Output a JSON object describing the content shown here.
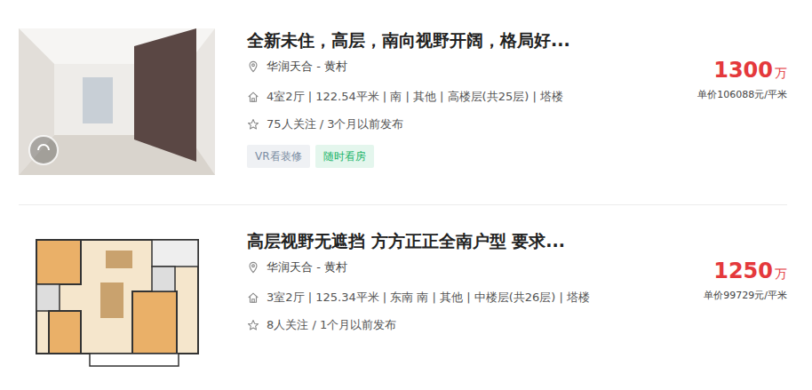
{
  "listings": [
    {
      "title": "全新未住，高层，南向视野开阔，格局好...",
      "location": "华润天合 - 黄村",
      "info": "4室2厅 | 122.54平米 | 南 | 其他 | 高楼层(共25层) | 塔楼",
      "follow": "75人关注 / 3个月以前发布",
      "tags": [
        {
          "label": "VR看装修",
          "color": "#7b8da3"
        },
        {
          "label": "随时看房",
          "color": "#21b469"
        }
      ],
      "price": "1300",
      "price_unit": "万",
      "unit_price": "单价106088元/平米",
      "image_kind": "photo",
      "vr": true
    },
    {
      "title": "高层视野无遮挡 方方正正全南户型 要求...",
      "location": "华润天合 - 黄村",
      "info": "3室2厅 | 125.34平米 | 东南 南 | 其他 | 中楼层(共26层) | 塔楼",
      "follow": "8人关注 / 1个月以前发布",
      "tags": [],
      "price": "1250",
      "price_unit": "万",
      "unit_price": "单价99729元/平米",
      "image_kind": "floorplan",
      "vr": false
    }
  ]
}
